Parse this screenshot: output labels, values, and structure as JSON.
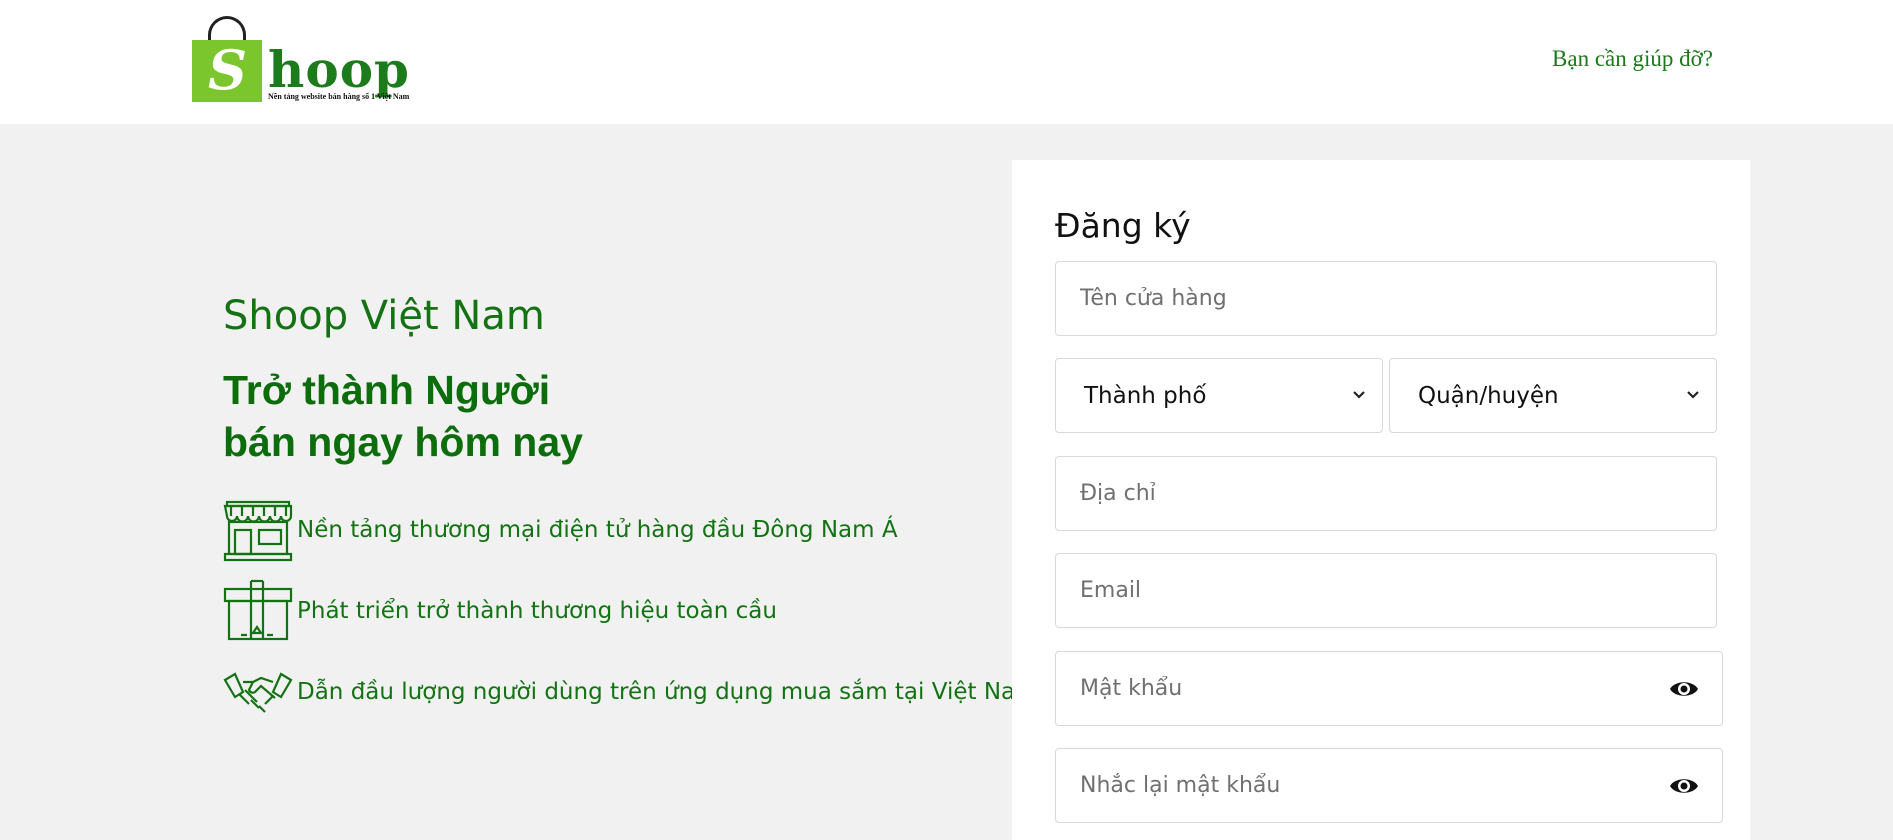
{
  "header": {
    "logo_letter": "S",
    "logo_word": "hoop",
    "logo_tagline": "Nền tảng website bán hàng số 1 Việt Nam",
    "help_link": "Bạn cần giúp đỡ?"
  },
  "intro": {
    "brand": "Shoop Việt Nam",
    "tagline_line1": "Trở thành Người",
    "tagline_line2": "bán ngay hôm nay",
    "features": [
      {
        "icon": "storefront-icon",
        "text": "Nền tảng thương mại điện tử hàng đầu Đông Nam Á"
      },
      {
        "icon": "gift-box-icon",
        "text": "Phát triển trở thành thương hiệu toàn cầu"
      },
      {
        "icon": "handshake-icon",
        "text": "Dẫn đầu lượng người dùng trên ứng dụng mua sắm tại Việt Nam"
      }
    ]
  },
  "form": {
    "title": "Đăng ký",
    "store_name_placeholder": "Tên cửa hàng",
    "city_select": "Thành phố",
    "district_select": "Quận/huyện",
    "address_placeholder": "Địa chỉ",
    "email_placeholder": "Email",
    "password_placeholder": "Mật khẩu",
    "confirm_password_placeholder": "Nhắc lại mật khẩu"
  },
  "colors": {
    "brand_green": "#137313",
    "logo_green": "#7bc62d",
    "background": "#f1f1f1"
  }
}
